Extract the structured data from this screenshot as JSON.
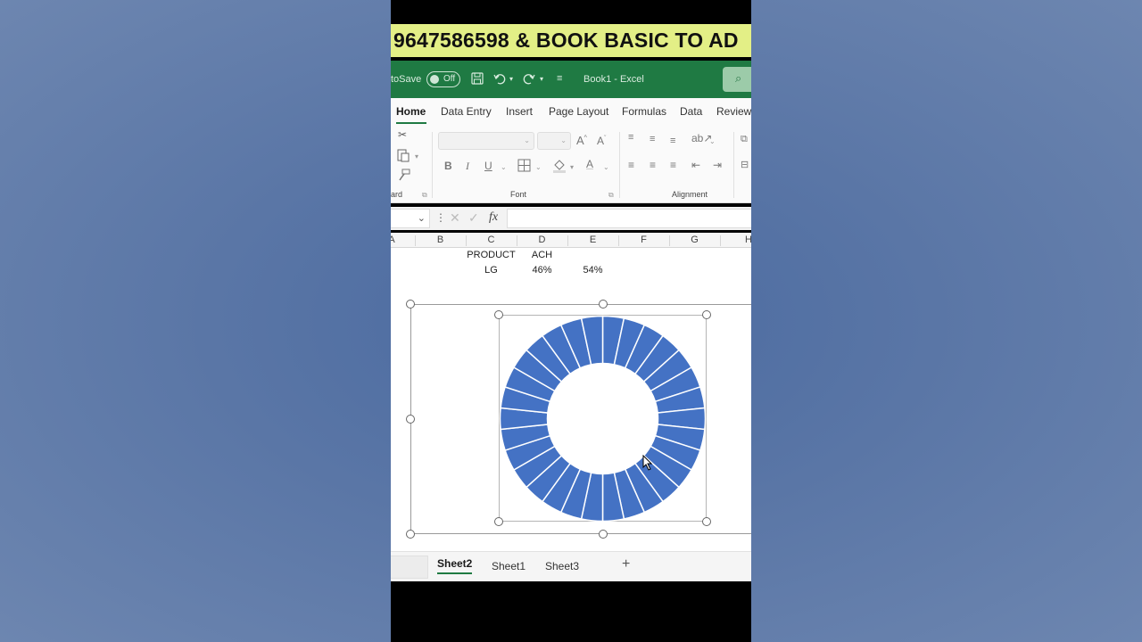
{
  "banner": {
    "text": "9647586598 & BOOK BASIC TO AD"
  },
  "titlebar": {
    "autosave_label": "toSave",
    "toggle_state": "Off",
    "doc_title": "Book1  -  Excel",
    "icons": [
      "save-icon",
      "undo-icon",
      "redo-icon",
      "customize-icon",
      "search-icon"
    ]
  },
  "ribbon_tabs": [
    "Home",
    "Data Entry",
    "Insert",
    "Page Layout",
    "Formulas",
    "Data",
    "Review"
  ],
  "ribbon": {
    "clipboard_label": "ard",
    "font_label": "Font",
    "alignment_label": "Alignment",
    "bold": "B",
    "italic": "I",
    "underline": "U",
    "font_color": "A"
  },
  "formula_bar": {
    "fx": "fx",
    "value": ""
  },
  "columns": [
    "A",
    "B",
    "C",
    "D",
    "E",
    "F",
    "G",
    "H"
  ],
  "cells": {
    "c1": "PRODUCT",
    "d1": "ACH",
    "c2": "LG",
    "d2": "46%",
    "e2": "54%"
  },
  "chart_data": {
    "type": "pie",
    "subtype": "doughnut",
    "segment_count": 30,
    "values": [
      1,
      1,
      1,
      1,
      1,
      1,
      1,
      1,
      1,
      1,
      1,
      1,
      1,
      1,
      1,
      1,
      1,
      1,
      1,
      1,
      1,
      1,
      1,
      1,
      1,
      1,
      1,
      1,
      1,
      1
    ],
    "color": "#4472c4",
    "separator_color": "#ffffff",
    "title": "",
    "legend": "none"
  },
  "sheet_tabs": [
    "Sheet2",
    "Sheet1",
    "Sheet3"
  ],
  "add_sheet": "+",
  "colors": {
    "excel_green": "#1f7a43",
    "banner": "#e3ef86",
    "accent_blue": "#4472c4"
  }
}
